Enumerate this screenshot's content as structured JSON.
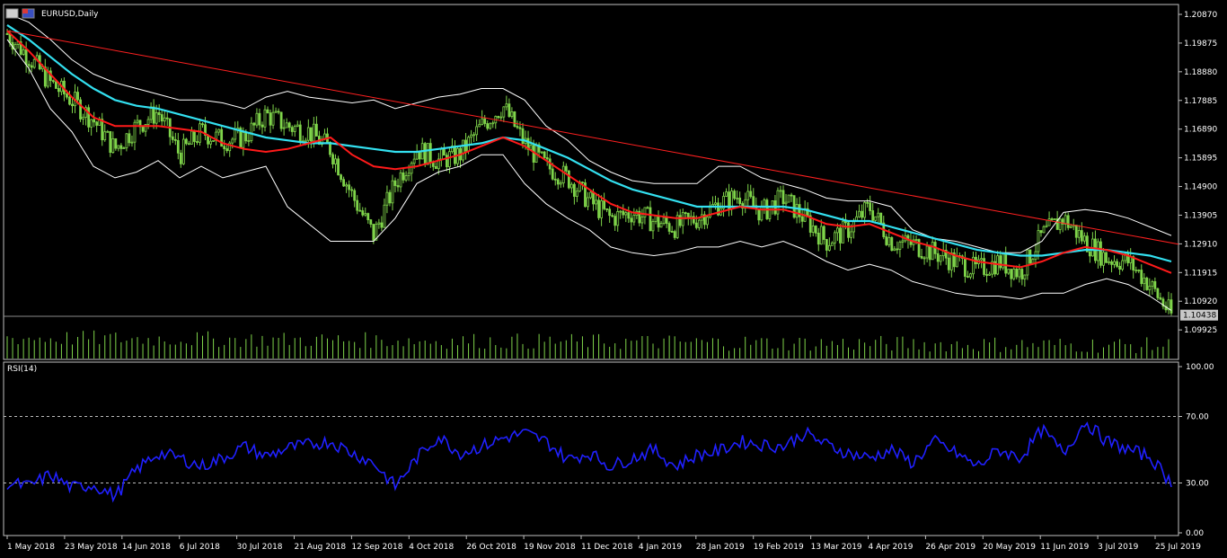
{
  "window": {
    "symbol_title": "EURUSD,Daily",
    "indicator_title": "RSI(14)",
    "current_price": "1.10438"
  },
  "colors": {
    "background": "#000000",
    "grid_border": "#c0c0c0",
    "candles": "#7fd44a",
    "bollinger": "#ffffff",
    "ma_fast": "#ff1a1a",
    "ma_slow": "#33e0f0",
    "trendline": "#ff2020",
    "rsi": "#2020ff",
    "volume": "#7fd44a"
  },
  "chart_data": [
    {
      "type": "line",
      "title": "EURUSD,Daily",
      "price_axis_ticks": [
        "1.20870",
        "1.19875",
        "1.18880",
        "1.17885",
        "1.16890",
        "1.15895",
        "1.14900",
        "1.13905",
        "1.12910",
        "1.11915",
        "1.10920",
        "1.09925"
      ],
      "ylim": [
        1.0993,
        1.2087
      ],
      "x_ticks": [
        "1 May 2018",
        "23 May 2018",
        "14 Jun 2018",
        "6 Jul 2018",
        "30 Jul 2018",
        "21 Aug 2018",
        "12 Sep 2018",
        "4 Oct 2018",
        "26 Oct 2018",
        "19 Nov 2018",
        "11 Dec 2018",
        "4 Jan 2019",
        "28 Jan 2019",
        "19 Feb 2019",
        "13 Mar 2019",
        "4 Apr 2019",
        "26 Apr 2019",
        "20 May 2019",
        "11 Jun 2019",
        "3 Jul 2019",
        "25 Jul 2019"
      ],
      "series": [
        {
          "name": "close",
          "values": [
            1.202,
            1.194,
            1.185,
            1.179,
            1.172,
            1.162,
            1.17,
            1.175,
            1.16,
            1.168,
            1.165,
            1.166,
            1.174,
            1.17,
            1.168,
            1.162,
            1.146,
            1.132,
            1.15,
            1.162,
            1.158,
            1.16,
            1.17,
            1.177,
            1.164,
            1.156,
            1.152,
            1.144,
            1.138,
            1.14,
            1.137,
            1.135,
            1.138,
            1.143,
            1.146,
            1.14,
            1.145,
            1.138,
            1.13,
            1.134,
            1.142,
            1.13,
            1.129,
            1.126,
            1.123,
            1.12,
            1.123,
            1.119,
            1.132,
            1.138,
            1.13,
            1.124,
            1.123,
            1.115,
            1.1044
          ]
        },
        {
          "name": "ma_fast",
          "values": [
            1.203,
            1.196,
            1.188,
            1.18,
            1.173,
            1.17,
            1.17,
            1.17,
            1.169,
            1.168,
            1.164,
            1.162,
            1.161,
            1.162,
            1.164,
            1.166,
            1.16,
            1.156,
            1.155,
            1.156,
            1.158,
            1.16,
            1.163,
            1.166,
            1.163,
            1.158,
            1.153,
            1.148,
            1.143,
            1.14,
            1.139,
            1.138,
            1.138,
            1.14,
            1.142,
            1.141,
            1.141,
            1.139,
            1.136,
            1.135,
            1.136,
            1.133,
            1.13,
            1.128,
            1.125,
            1.123,
            1.122,
            1.121,
            1.123,
            1.126,
            1.128,
            1.127,
            1.125,
            1.122,
            1.119
          ]
        },
        {
          "name": "ma_slow",
          "values": [
            1.205,
            1.2,
            1.194,
            1.188,
            1.183,
            1.179,
            1.177,
            1.176,
            1.174,
            1.172,
            1.17,
            1.168,
            1.166,
            1.165,
            1.164,
            1.164,
            1.163,
            1.162,
            1.161,
            1.161,
            1.162,
            1.163,
            1.164,
            1.166,
            1.165,
            1.162,
            1.159,
            1.155,
            1.151,
            1.148,
            1.146,
            1.144,
            1.142,
            1.142,
            1.142,
            1.142,
            1.142,
            1.141,
            1.139,
            1.137,
            1.137,
            1.135,
            1.133,
            1.131,
            1.129,
            1.127,
            1.126,
            1.125,
            1.125,
            1.126,
            1.127,
            1.127,
            1.126,
            1.125,
            1.123
          ]
        },
        {
          "name": "bb_upper",
          "values": [
            1.209,
            1.206,
            1.2,
            1.193,
            1.188,
            1.185,
            1.183,
            1.181,
            1.179,
            1.179,
            1.178,
            1.176,
            1.18,
            1.182,
            1.18,
            1.179,
            1.178,
            1.179,
            1.176,
            1.178,
            1.18,
            1.181,
            1.183,
            1.183,
            1.179,
            1.17,
            1.165,
            1.158,
            1.154,
            1.151,
            1.15,
            1.15,
            1.15,
            1.156,
            1.156,
            1.152,
            1.15,
            1.148,
            1.145,
            1.144,
            1.144,
            1.142,
            1.134,
            1.131,
            1.13,
            1.128,
            1.126,
            1.126,
            1.13,
            1.14,
            1.141,
            1.14,
            1.138,
            1.135,
            1.132
          ]
        },
        {
          "name": "bb_lower",
          "values": [
            1.2,
            1.19,
            1.176,
            1.168,
            1.156,
            1.152,
            1.154,
            1.158,
            1.152,
            1.156,
            1.152,
            1.154,
            1.156,
            1.142,
            1.136,
            1.13,
            1.13,
            1.13,
            1.138,
            1.15,
            1.154,
            1.156,
            1.16,
            1.16,
            1.15,
            1.143,
            1.138,
            1.134,
            1.128,
            1.126,
            1.125,
            1.126,
            1.128,
            1.128,
            1.13,
            1.128,
            1.13,
            1.127,
            1.123,
            1.12,
            1.122,
            1.12,
            1.116,
            1.114,
            1.112,
            1.111,
            1.111,
            1.11,
            1.112,
            1.112,
            1.115,
            1.117,
            1.115,
            1.111,
            1.106
          ]
        }
      ],
      "trendline": {
        "from": [
          0,
          1.203
        ],
        "to": [
          54,
          1.129
        ]
      }
    },
    {
      "type": "line",
      "title": "RSI(14)",
      "y_ticks": [
        "100.00",
        "70.00",
        "30.00",
        "0.00"
      ],
      "ylim": [
        0,
        100
      ],
      "levels": [
        70,
        30
      ],
      "series": [
        {
          "name": "RSI(14)",
          "values": [
            30,
            28,
            35,
            27,
            29,
            22,
            38,
            48,
            45,
            40,
            45,
            52,
            46,
            51,
            53,
            55,
            48,
            42,
            28,
            45,
            58,
            48,
            52,
            57,
            60,
            55,
            44,
            48,
            40,
            45,
            50,
            40,
            47,
            49,
            55,
            53,
            52,
            60,
            53,
            48,
            45,
            50,
            42,
            55,
            48,
            40,
            50,
            45,
            62,
            48,
            67,
            55,
            50,
            46,
            30
          ]
        }
      ]
    }
  ]
}
